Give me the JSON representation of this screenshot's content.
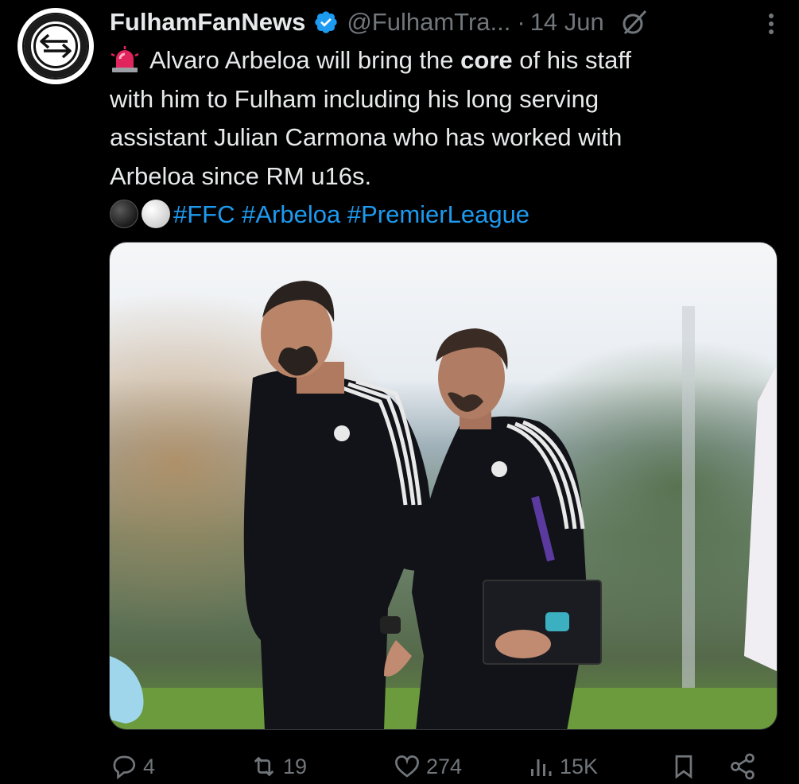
{
  "author": {
    "display_name": "FulhamFanNews",
    "handle": "@FulhamTra...",
    "separator": "·",
    "date": "14 Jun",
    "avatar_icon": "transfer-arrows-icon",
    "verified_color": "#1d9bf0"
  },
  "tweet": {
    "line1_before": "Alvaro Arbeloa will bring the ",
    "line1_bold": "core",
    "line1_after": " of his staff",
    "line2": "with him to Fulham including his long serving",
    "line3": "assistant Julian Carmona who has worked with",
    "line4": "Arbeloa since RM u16s.",
    "hashtags": [
      "#FFC",
      "#Arbeloa",
      "#PremierLeague"
    ]
  },
  "media": {
    "alt": "Two Real Madrid coaches walking on a training ground",
    "jacket_color": "#111318",
    "stripe_color": "#e9e9e9",
    "accent_color": "#5b3aa0"
  },
  "actions": {
    "replies": "4",
    "reposts": "19",
    "likes": "274",
    "views": "15K"
  },
  "colors": {
    "background": "#000000",
    "text": "#e7e9ea",
    "muted": "#71767b",
    "link": "#1d9bf0"
  }
}
